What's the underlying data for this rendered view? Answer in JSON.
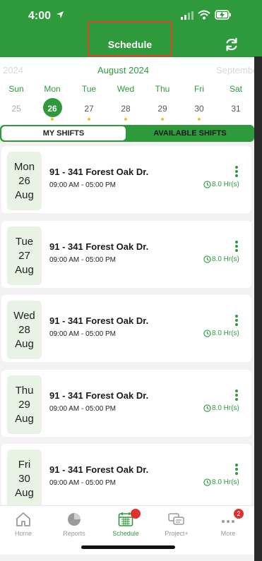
{
  "status_bar": {
    "time": "4:00"
  },
  "header": {
    "title": "Schedule"
  },
  "calendar": {
    "prev_month": "2024",
    "month": "August 2024",
    "next_month": "September",
    "days": [
      {
        "dow": "Sun",
        "num": "25"
      },
      {
        "dow": "Mon",
        "num": "26"
      },
      {
        "dow": "Tue",
        "num": "27"
      },
      {
        "dow": "Wed",
        "num": "28"
      },
      {
        "dow": "Thu",
        "num": "29"
      },
      {
        "dow": "Fri",
        "num": "30"
      },
      {
        "dow": "Sat",
        "num": "31"
      }
    ]
  },
  "tabs_segment": {
    "my_shifts": "MY SHIFTS",
    "available": "AVAILABLE SHIFTS"
  },
  "shifts": [
    {
      "dow": "Mon",
      "day": "26",
      "mon": "Aug",
      "address": "91 - 341 Forest Oak Dr.",
      "time": "09:00 AM - 05:00 PM",
      "hours": "8.0 Hr(s)"
    },
    {
      "dow": "Tue",
      "day": "27",
      "mon": "Aug",
      "address": "91 - 341 Forest Oak Dr.",
      "time": "09:00 AM - 05:00 PM",
      "hours": "8.0 Hr(s)"
    },
    {
      "dow": "Wed",
      "day": "28",
      "mon": "Aug",
      "address": "91 - 341 Forest Oak Dr.",
      "time": "09:00 AM - 05:00 PM",
      "hours": "8.0 Hr(s)"
    },
    {
      "dow": "Thu",
      "day": "29",
      "mon": "Aug",
      "address": "91 - 341 Forest Oak Dr.",
      "time": "09:00 AM - 05:00 PM",
      "hours": "8.0 Hr(s)"
    },
    {
      "dow": "Fri",
      "day": "30",
      "mon": "Aug",
      "address": "91 - 341 Forest Oak Dr.",
      "time": "09:00 AM - 05:00 PM",
      "hours": "8.0 Hr(s)"
    }
  ],
  "tabbar": {
    "home": "Home",
    "reports": "Reports",
    "schedule": "Schedule",
    "project": "Project+",
    "more": "More",
    "more_badge": "2"
  },
  "colors": {
    "brand_green": "#2f9a3c",
    "badge_red": "#e0312e",
    "dot_yellow": "#f2c12e",
    "highlight_box": "#e0402e"
  }
}
